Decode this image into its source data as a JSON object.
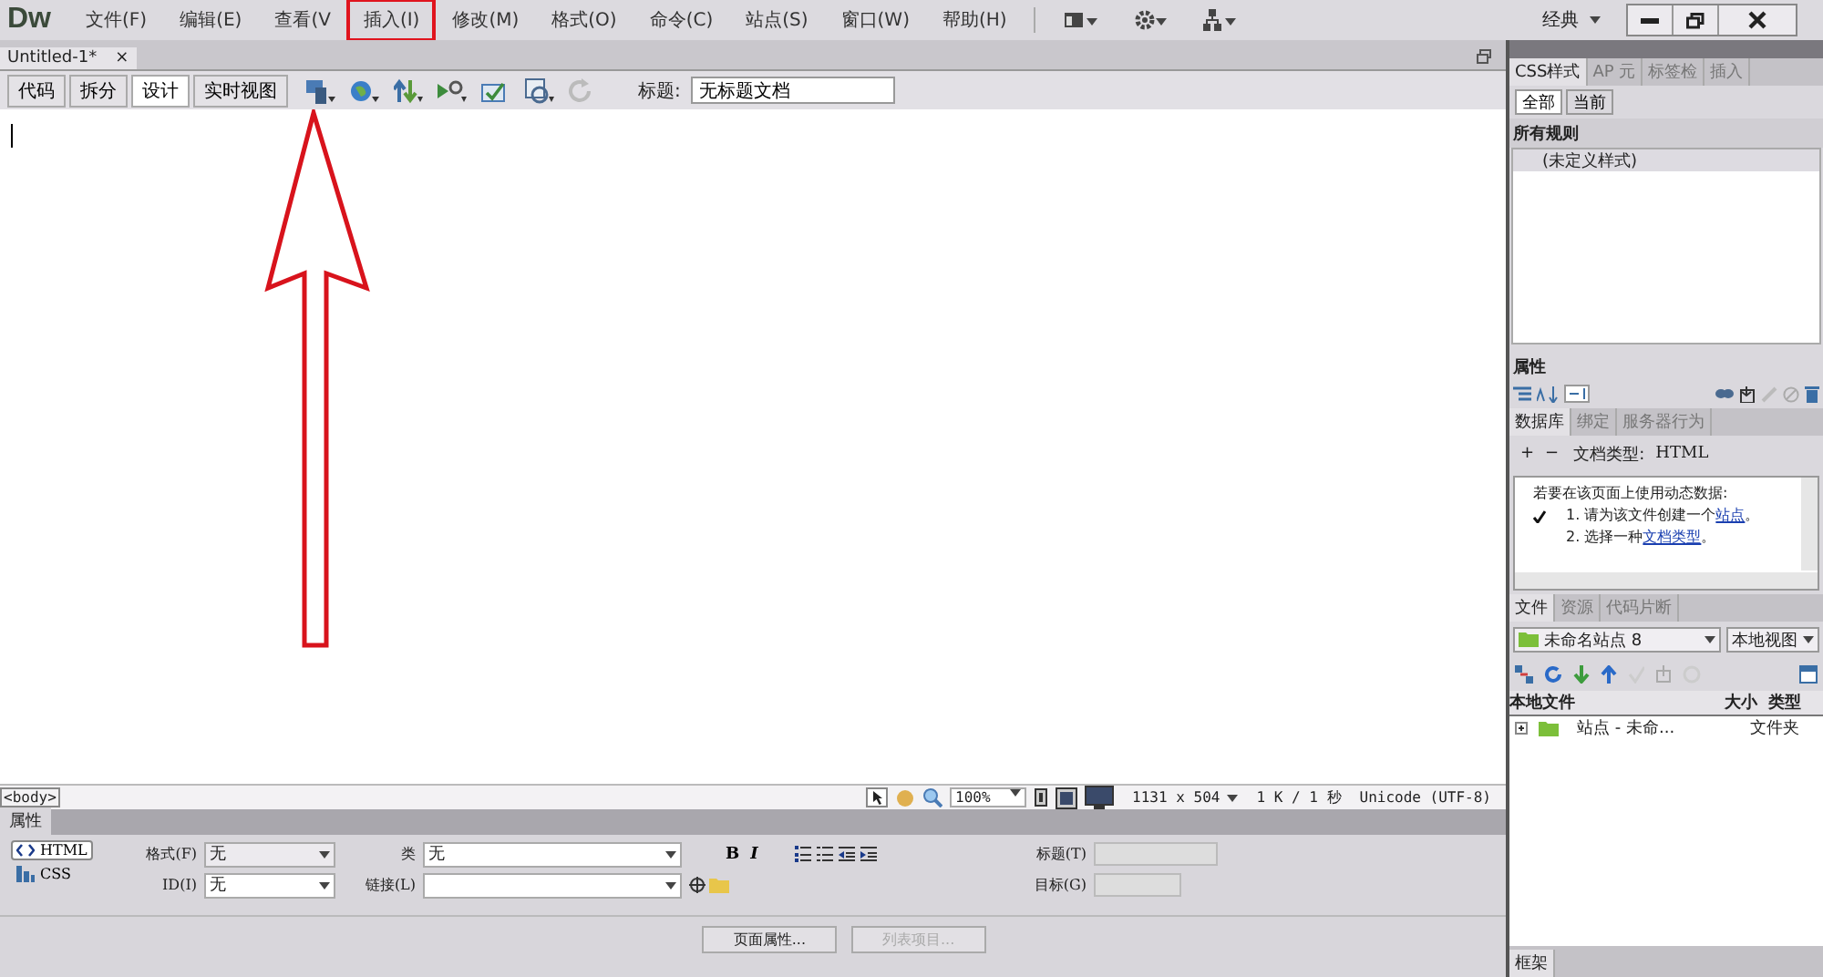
{
  "app_logo": "Dw",
  "menu": [
    {
      "label": "文件(F)",
      "highlighted": false
    },
    {
      "label": "编辑(E)",
      "highlighted": false
    },
    {
      "label": "查看(V",
      "highlighted": false
    },
    {
      "label": "插入(I)",
      "highlighted": true
    },
    {
      "label": "修改(M)",
      "highlighted": false
    },
    {
      "label": "格式(O)",
      "highlighted": false
    },
    {
      "label": "命令(C)",
      "highlighted": false
    },
    {
      "label": "站点(S)",
      "highlighted": false
    },
    {
      "label": "窗口(W)",
      "highlighted": false
    },
    {
      "label": "帮助(H)",
      "highlighted": false
    }
  ],
  "workspace": "经典",
  "document_tab": {
    "title": "Untitled-1*",
    "close": "×"
  },
  "view_buttons": [
    {
      "label": "代码",
      "selected": false
    },
    {
      "label": "拆分",
      "selected": false
    },
    {
      "label": "设计",
      "selected": true
    },
    {
      "label": "实时视图",
      "selected": false
    }
  ],
  "title_field": {
    "label": "标题:",
    "value": "无标题文档"
  },
  "status_bar": {
    "tag": "<body>",
    "zoom": "100%",
    "size": "1131 x 504",
    "weight": "1 K / 1 秒",
    "encoding": "Unicode (UTF-8)"
  },
  "properties": {
    "title": "属性",
    "modes": [
      {
        "label": "HTML",
        "selected": true,
        "kind": "html"
      },
      {
        "label": "CSS",
        "selected": false,
        "kind": "css"
      }
    ],
    "format_label": "格式(F)",
    "format_value": "无",
    "id_label": "ID(I)",
    "id_value": "无",
    "class_label": "类",
    "class_value": "无",
    "link_label": "链接(L)",
    "bold": "B",
    "italic": "I",
    "heading_label": "标题(T)",
    "target_label": "目标(G)",
    "buttons": [
      {
        "label": "页面属性...",
        "disabled": false
      },
      {
        "label": "列表项目...",
        "disabled": true
      }
    ]
  },
  "css_panel": {
    "tabs": [
      {
        "label": "CSS样式",
        "selected": true
      },
      {
        "label": "AP 元",
        "selected": false
      },
      {
        "label": "标签检",
        "selected": false
      },
      {
        "label": "插入",
        "selected": false
      }
    ],
    "filters": [
      {
        "label": "全部",
        "selected": true
      },
      {
        "label": "当前",
        "selected": false
      }
    ],
    "heading": "所有规则",
    "rules": [
      {
        "label": "(未定义样式)",
        "selected": true
      }
    ],
    "properties_title": "属性"
  },
  "data_panel": {
    "tabs": [
      {
        "label": "数据库",
        "selected": true
      },
      {
        "label": "绑定",
        "selected": false
      },
      {
        "label": "服务器行为",
        "selected": false
      }
    ],
    "actions": [
      "+",
      "−"
    ],
    "doc_type_label": "文档类型:",
    "doc_type": "HTML",
    "intro": "若要在该页面上使用动态数据:",
    "steps": [
      {
        "checked": true,
        "text": "1. 请为该文件创建一个",
        "link": "站点",
        "end": "。"
      },
      {
        "checked": false,
        "text": "2. 选择一种",
        "link": "文档类型",
        "end": "。"
      }
    ]
  },
  "files_panel": {
    "tabs": [
      {
        "label": "文件",
        "selected": true
      },
      {
        "label": "资源",
        "selected": false
      },
      {
        "label": "代码片断",
        "selected": false
      }
    ],
    "site": "未命名站点 8",
    "view": "本地视图",
    "columns": [
      "本地文件",
      "大小",
      "类型"
    ],
    "rows": [
      {
        "name": "站点 - 未命...",
        "type": "文件夹",
        "expanded": false
      }
    ]
  },
  "frames_panel": {
    "title": "框架"
  }
}
